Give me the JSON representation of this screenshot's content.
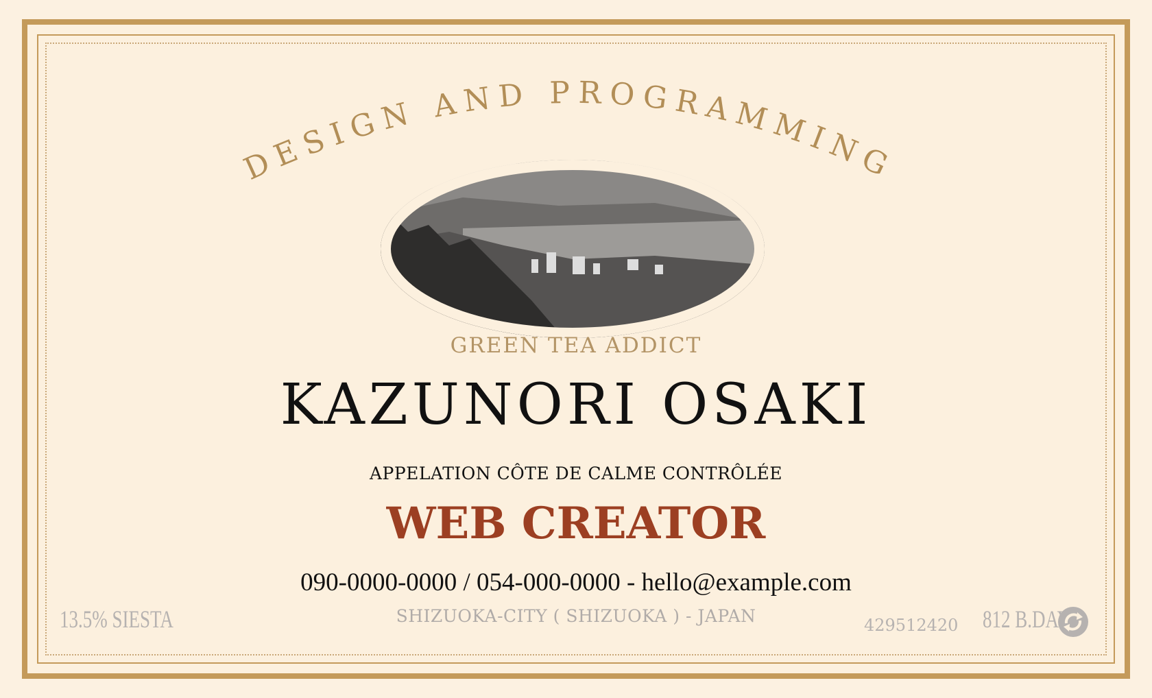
{
  "arc_heading": "DESIGN AND PROGRAMMING",
  "tagline": "GREEN TEA ADDICT",
  "name": "KAZUNORI OSAKI",
  "appellation": "APPELATION CÔTE DE CALME CONTRÔLÉE",
  "role": "WEB CREATOR",
  "contact": "090-0000-0000 / 054-000-0000 - hello@example.com",
  "location": "SHIZUOKA-CITY ( SHIZUOKA ) - JAPAN",
  "corner_left": "13.5% SIESTA",
  "corner_right_number": "429512420",
  "corner_right_bday": "812 B.DAY",
  "icons": {
    "landscape": "mountain-landscape-icon",
    "recycle": "recycle-icon"
  },
  "colors": {
    "background": "#fcf1e1",
    "border": "#c49a5a",
    "arc_text": "#b28e57",
    "role_text": "#9c3f22",
    "muted_text": "#b6b2b0"
  }
}
